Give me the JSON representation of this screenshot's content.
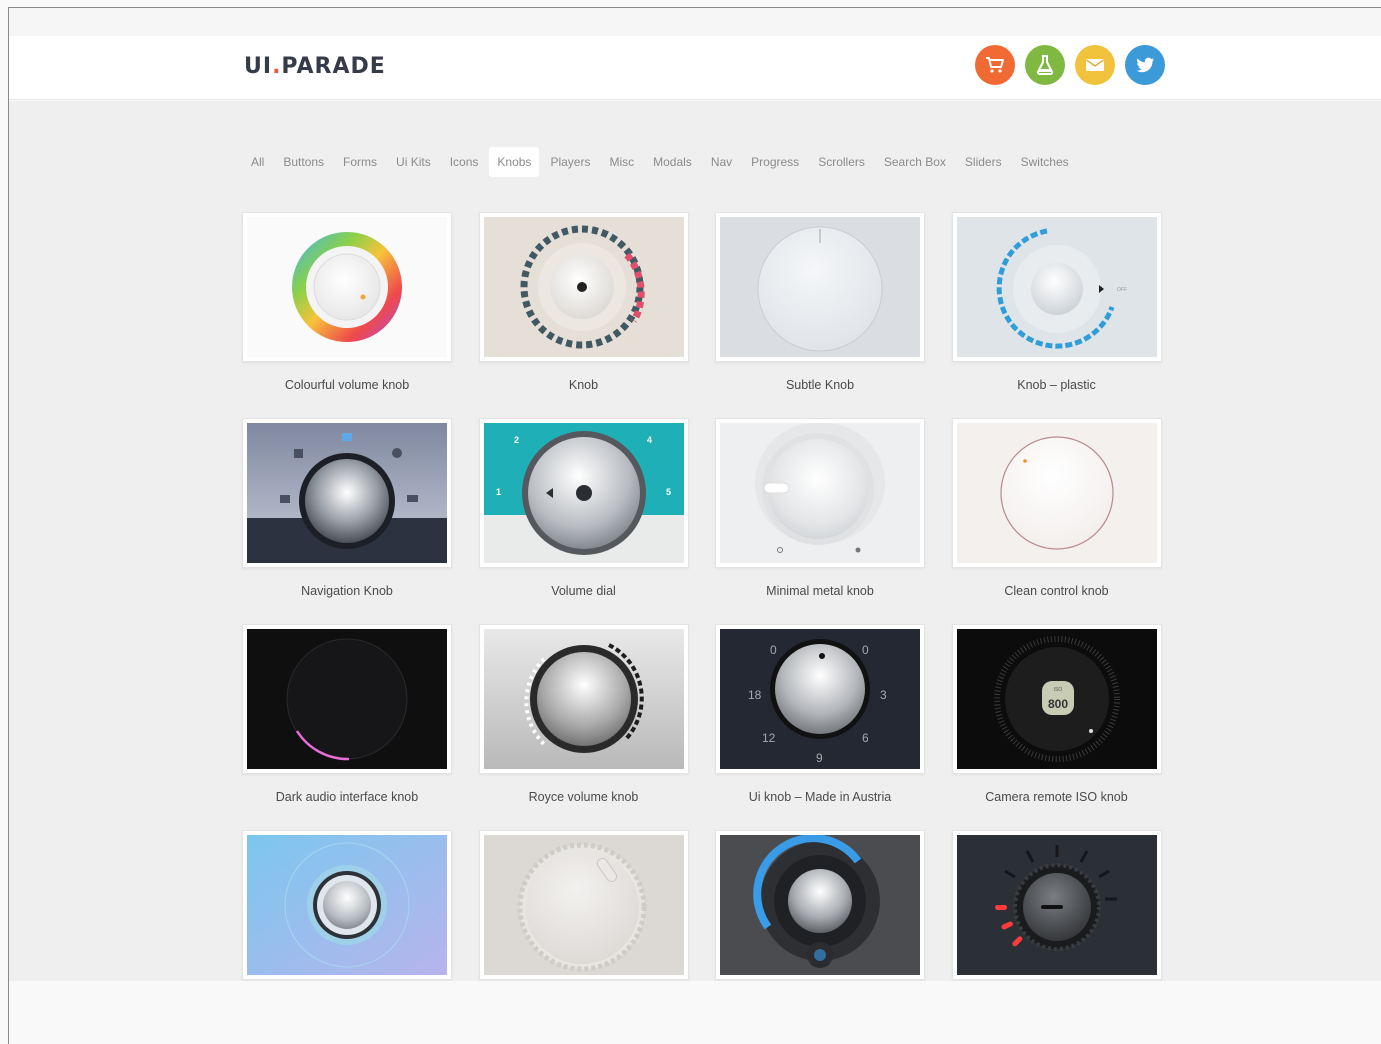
{
  "site": {
    "logo_part1": "UI",
    "logo_dot": ".",
    "logo_part2": "PARADE"
  },
  "social": [
    {
      "name": "cart-icon",
      "color": "#f26a33"
    },
    {
      "name": "flask-icon",
      "color": "#7fb941"
    },
    {
      "name": "mail-icon",
      "color": "#f1c23c"
    },
    {
      "name": "twitter-icon",
      "color": "#3c9ad9"
    }
  ],
  "nav": {
    "items": [
      "All",
      "Buttons",
      "Forms",
      "Ui Kits",
      "Icons",
      "Knobs",
      "Players",
      "Misc",
      "Modals",
      "Nav",
      "Progress",
      "Scrollers",
      "Search Box",
      "Sliders",
      "Switches"
    ],
    "active": "Knobs"
  },
  "cards": [
    {
      "title": "Colourful volume knob"
    },
    {
      "title": "Knob"
    },
    {
      "title": "Subtle Knob"
    },
    {
      "title": "Knob – plastic"
    },
    {
      "title": "Navigation Knob"
    },
    {
      "title": "Volume dial"
    },
    {
      "title": "Minimal metal knob"
    },
    {
      "title": "Clean control knob"
    },
    {
      "title": "Dark audio interface knob"
    },
    {
      "title": "Royce volume knob"
    },
    {
      "title": "Ui knob – Made in Austria"
    },
    {
      "title": "Camera remote ISO knob"
    },
    {
      "title": ""
    },
    {
      "title": ""
    },
    {
      "title": ""
    },
    {
      "title": ""
    }
  ],
  "thumb_text": {
    "volume_dial_marks": [
      "2",
      "4",
      "1",
      "5"
    ],
    "austria_marks": [
      "0",
      "0",
      "18",
      "3",
      "12",
      "6",
      "9"
    ],
    "iso_value": "800",
    "iso_label": "ISO",
    "plastic_label": "OFF"
  },
  "colors": {
    "accent_orange": "#f26a33",
    "nav_active_bg": "#ffffff",
    "page_bg": "#efefef"
  }
}
